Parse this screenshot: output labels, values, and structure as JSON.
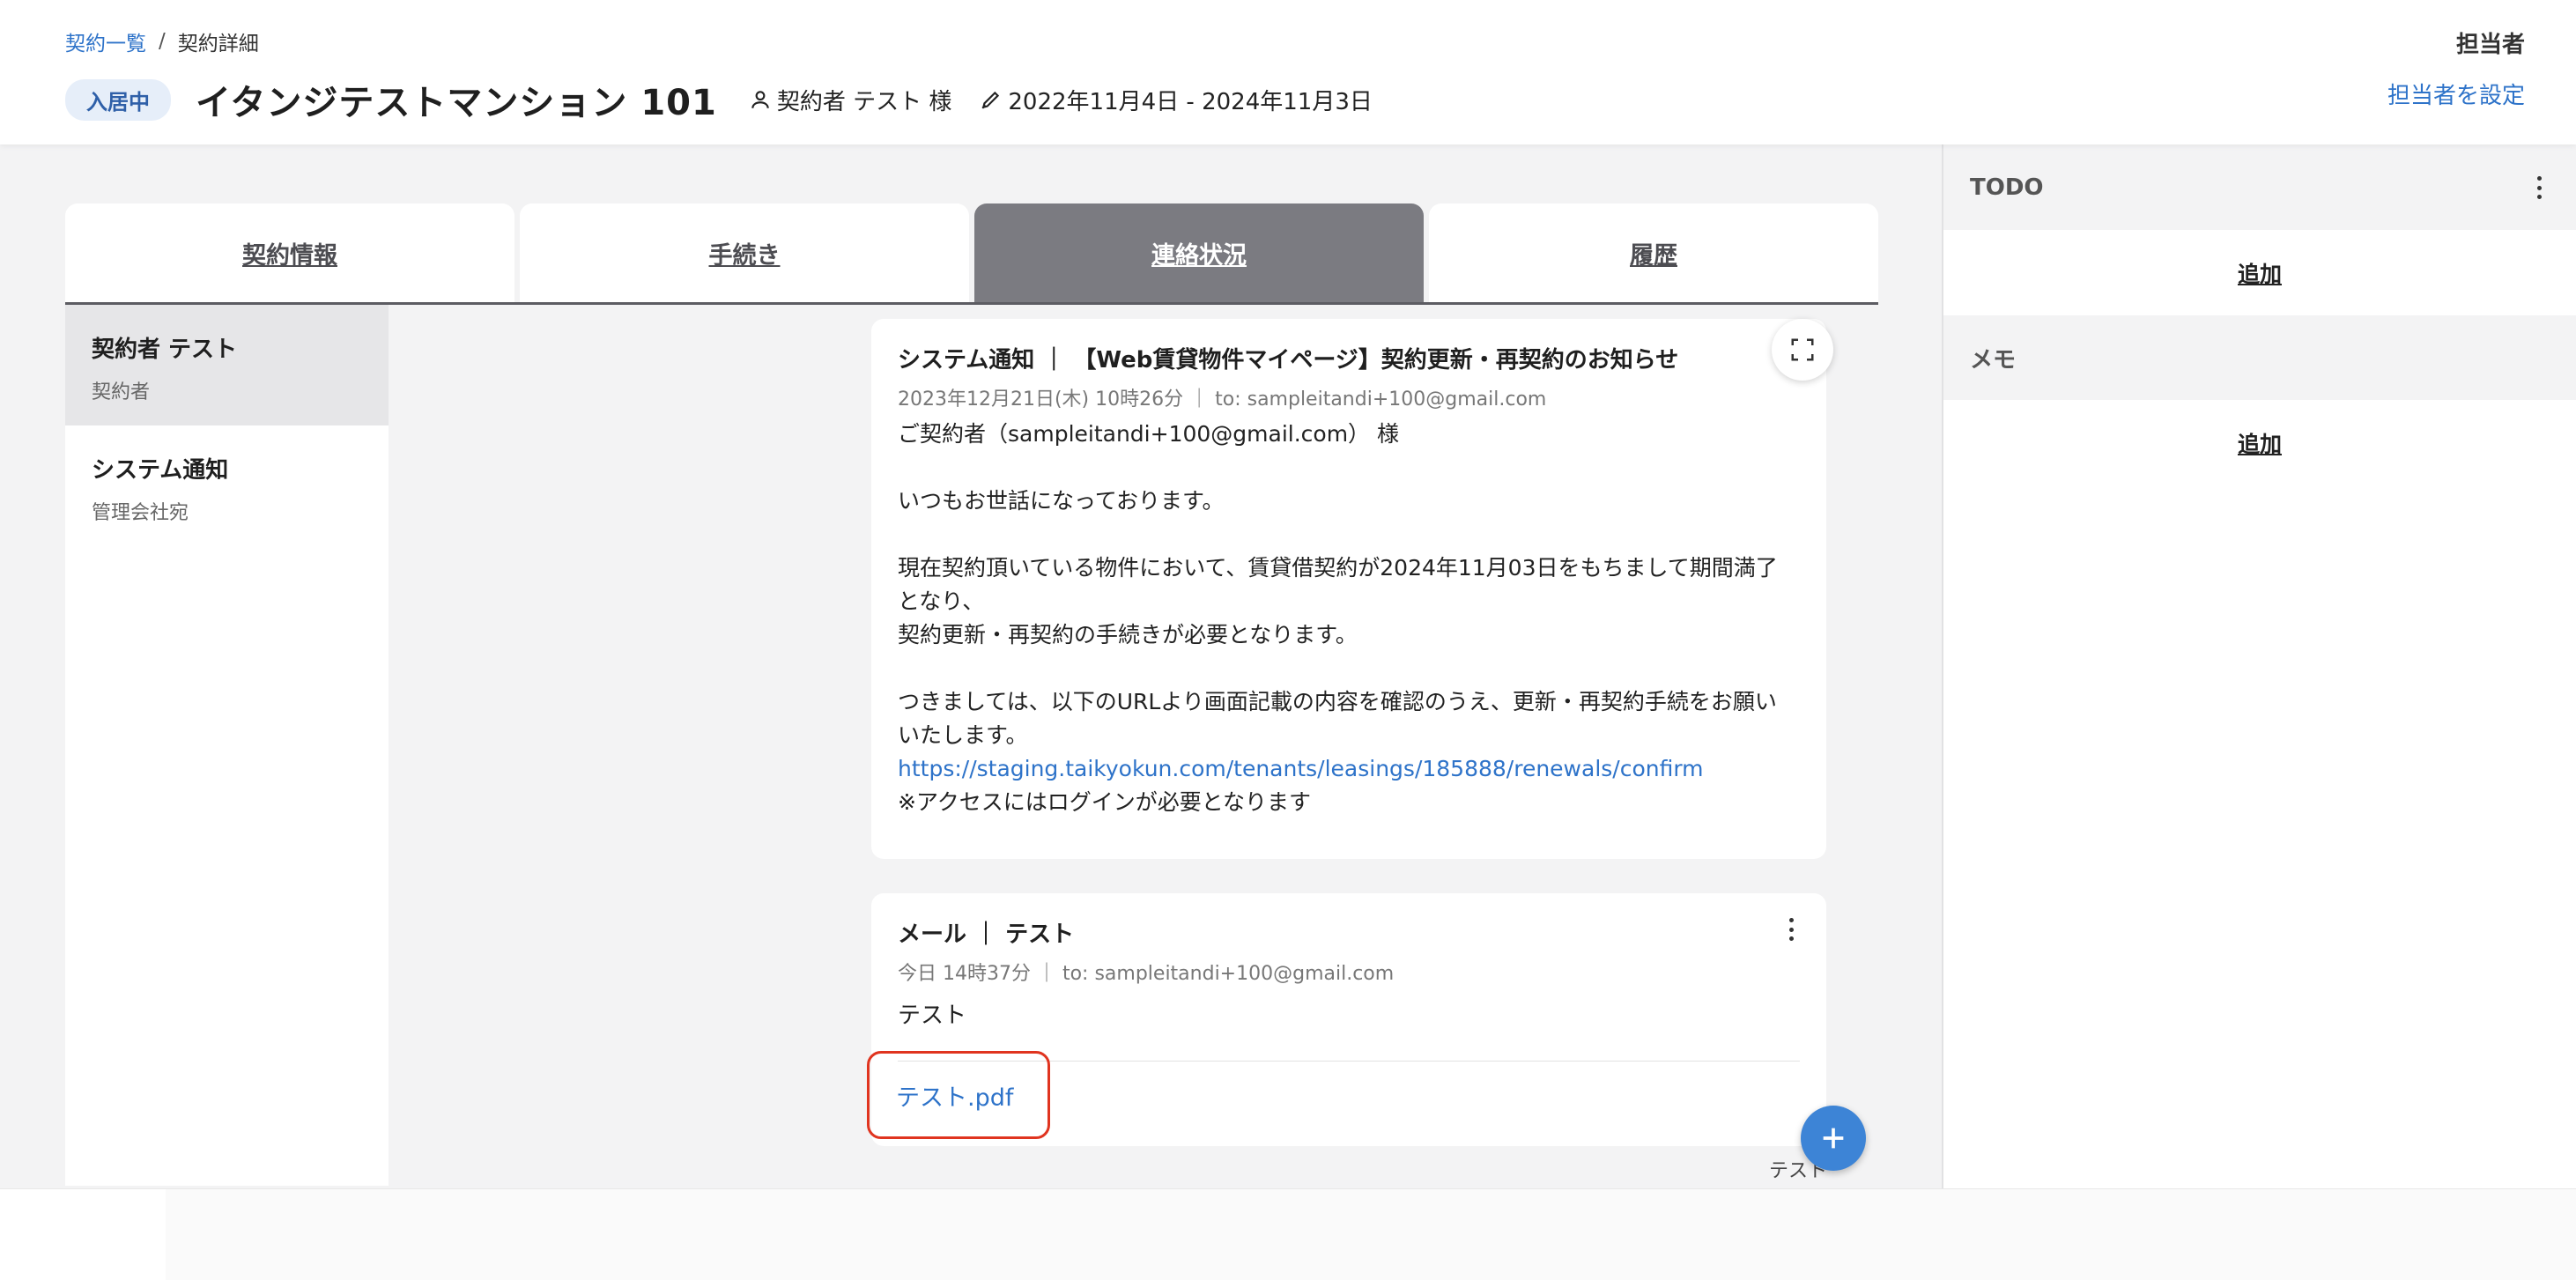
{
  "breadcrumb": {
    "list": "契約一覧",
    "separator": "/",
    "current": "契約詳細"
  },
  "header": {
    "status": "入居中",
    "title": "イタンジテストマンション 101",
    "contractor": "契約者 テスト 様",
    "period": "2022年11月4日 - 2024年11月3日",
    "assignee_label": "担当者",
    "assignee_action": "担当者を設定"
  },
  "tabs": [
    {
      "label": "契約情報"
    },
    {
      "label": "手続き"
    },
    {
      "label": "連絡状況"
    },
    {
      "label": "履歴"
    }
  ],
  "threads": [
    {
      "name": "契約者 テスト",
      "sub": "契約者"
    },
    {
      "name": "システム通知",
      "sub": "管理会社宛"
    }
  ],
  "messages": {
    "system": {
      "subject": "システム通知 ｜ 【Web賃貸物件マイページ】契約更新・再契約のお知らせ",
      "meta": "2023年12月21日(木) 10時26分 ｜ to: sampleitandi+100@gmail.com",
      "greeting": "ご契約者（sampleitandi+100@gmail.com） 様",
      "line1": "いつもお世話になっております。",
      "line2a": "現在契約頂いている物件において、賃貸借契約が2024年11月03日をもちまして期間満了となり、",
      "line2b": "契約更新・再契約の手続きが必要となります。",
      "line3": "つきましては、以下のURLより画面記載の内容を確認のうえ、更新・再契約手続をお願いいたします。",
      "url": "https://staging.taikyokun.com/tenants/leasings/185888/renewals/confirm",
      "note": "※アクセスにはログインが必要となります"
    },
    "mail": {
      "subject": "メール ｜ テスト",
      "meta": "今日 14時37分 ｜ to: sampleitandi+100@gmail.com",
      "body": "テスト",
      "attachment": "テスト.pdf"
    }
  },
  "tooltip": "テスト",
  "right_panel": {
    "todo_title": "TODO",
    "todo_add": "追加",
    "memo_title": "メモ",
    "memo_add": "追加"
  }
}
